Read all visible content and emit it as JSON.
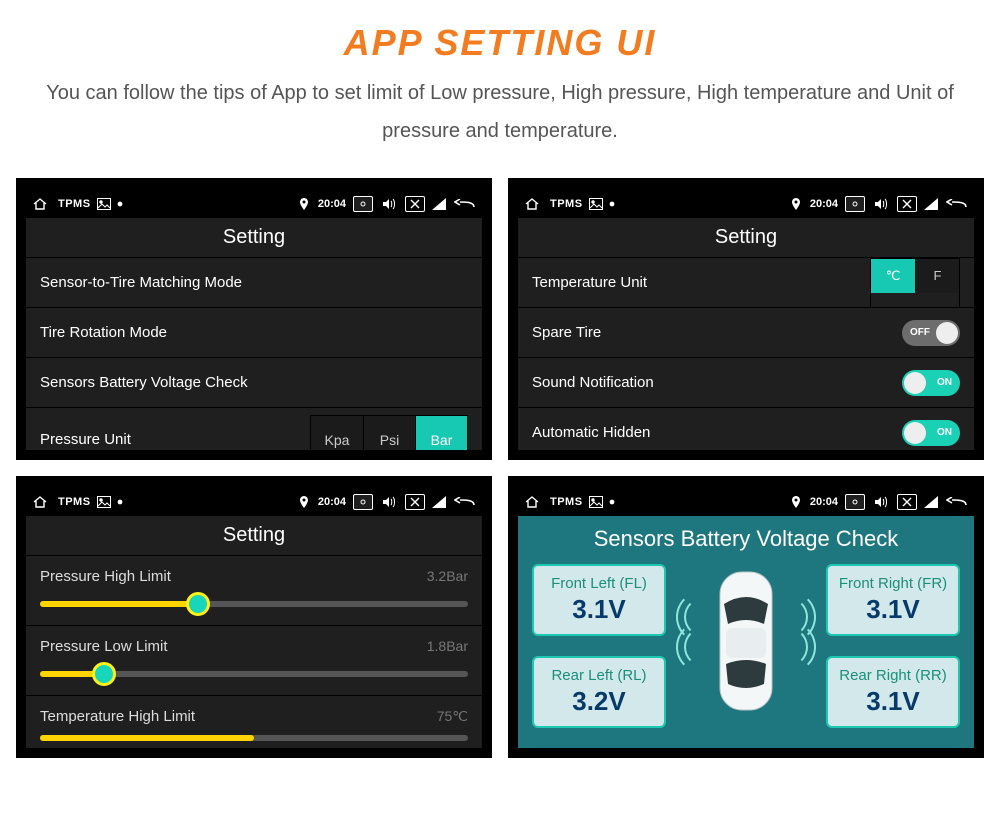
{
  "header": {
    "title": "APP SETTING UI",
    "subtitle": "You can follow the tips of App to set limit of Low pressure, High pressure, High temperature and Unit of pressure and temperature."
  },
  "statusbar": {
    "app": "TPMS",
    "time": "20:04"
  },
  "pane1": {
    "title": "Setting",
    "rows": {
      "r1": "Sensor-to-Tire Matching Mode",
      "r2": "Tire Rotation Mode",
      "r3": "Sensors Battery Voltage Check",
      "r4": "Pressure Unit"
    },
    "pressure_options": {
      "o1": "Kpa",
      "o2": "Psi",
      "o3": "Bar"
    }
  },
  "pane2": {
    "title": "Setting",
    "rows": {
      "temp": "Temperature Unit",
      "spare": "Spare Tire",
      "sound": "Sound Notification",
      "auto": "Automatic Hidden"
    },
    "temp_options": {
      "c": "℃",
      "f": "F"
    },
    "switch": {
      "on": "ON",
      "off": "OFF"
    }
  },
  "pane3": {
    "title": "Setting",
    "sliders": {
      "s1": {
        "label": "Pressure High Limit",
        "value": "3.2Bar",
        "pct": 37
      },
      "s2": {
        "label": "Pressure Low Limit",
        "value": "1.8Bar",
        "pct": 15
      },
      "s3": {
        "label": "Temperature High Limit",
        "value": "75℃",
        "pct": 50
      }
    }
  },
  "pane4": {
    "title": "Sensors Battery Voltage Check",
    "cards": {
      "fl": {
        "label": "Front Left (FL)",
        "value": "3.1V"
      },
      "fr": {
        "label": "Front Right (FR)",
        "value": "3.1V"
      },
      "rl": {
        "label": "Rear Left (RL)",
        "value": "3.2V"
      },
      "rr": {
        "label": "Rear Right (RR)",
        "value": "3.1V"
      }
    }
  }
}
